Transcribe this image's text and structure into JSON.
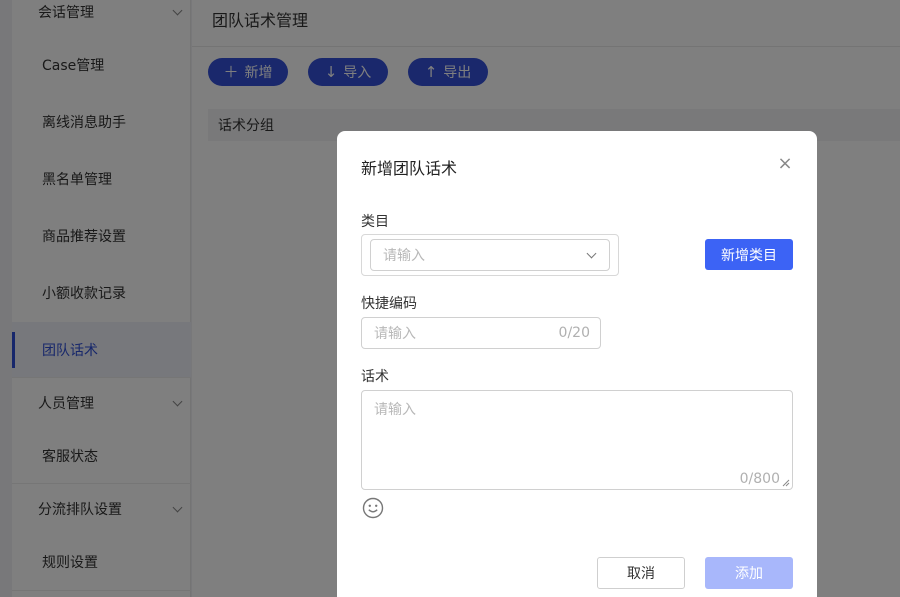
{
  "sidebar": {
    "groups": [
      {
        "label": "会话管理"
      },
      {
        "label": "人员管理"
      },
      {
        "label": "分流排队设置"
      }
    ],
    "items": [
      {
        "label": "Case管理"
      },
      {
        "label": "离线消息助手"
      },
      {
        "label": "黑名单管理"
      },
      {
        "label": "商品推荐设置"
      },
      {
        "label": "小额收款记录"
      },
      {
        "label": "团队话术"
      },
      {
        "label": "客服状态"
      },
      {
        "label": "规则设置"
      }
    ],
    "active_item": "团队话术"
  },
  "main": {
    "title": "团队话术管理",
    "toolbar": {
      "add_label": "新增",
      "import_label": "导入",
      "export_label": "导出"
    },
    "table": {
      "columns": [
        "话术分组"
      ]
    }
  },
  "dialog": {
    "title": "新增团队话术",
    "category": {
      "label": "类目",
      "placeholder": "请输入",
      "add_button": "新增类目"
    },
    "shortcut": {
      "label": "快捷编码",
      "placeholder": "请输入",
      "counter": "0/20"
    },
    "script": {
      "label": "话术",
      "placeholder": "请输入",
      "counter": "0/800"
    },
    "cancel_label": "取消",
    "submit_label": "添加"
  },
  "colors": {
    "accent": "#3451d9",
    "primary_button": "#3c63f5",
    "disabled_button": "#a8b7fb"
  },
  "icons": {
    "close": "close-icon",
    "emoji": "emoji-icon",
    "add": "plus-icon",
    "import": "arrow-down-icon",
    "export": "arrow-up-icon"
  }
}
